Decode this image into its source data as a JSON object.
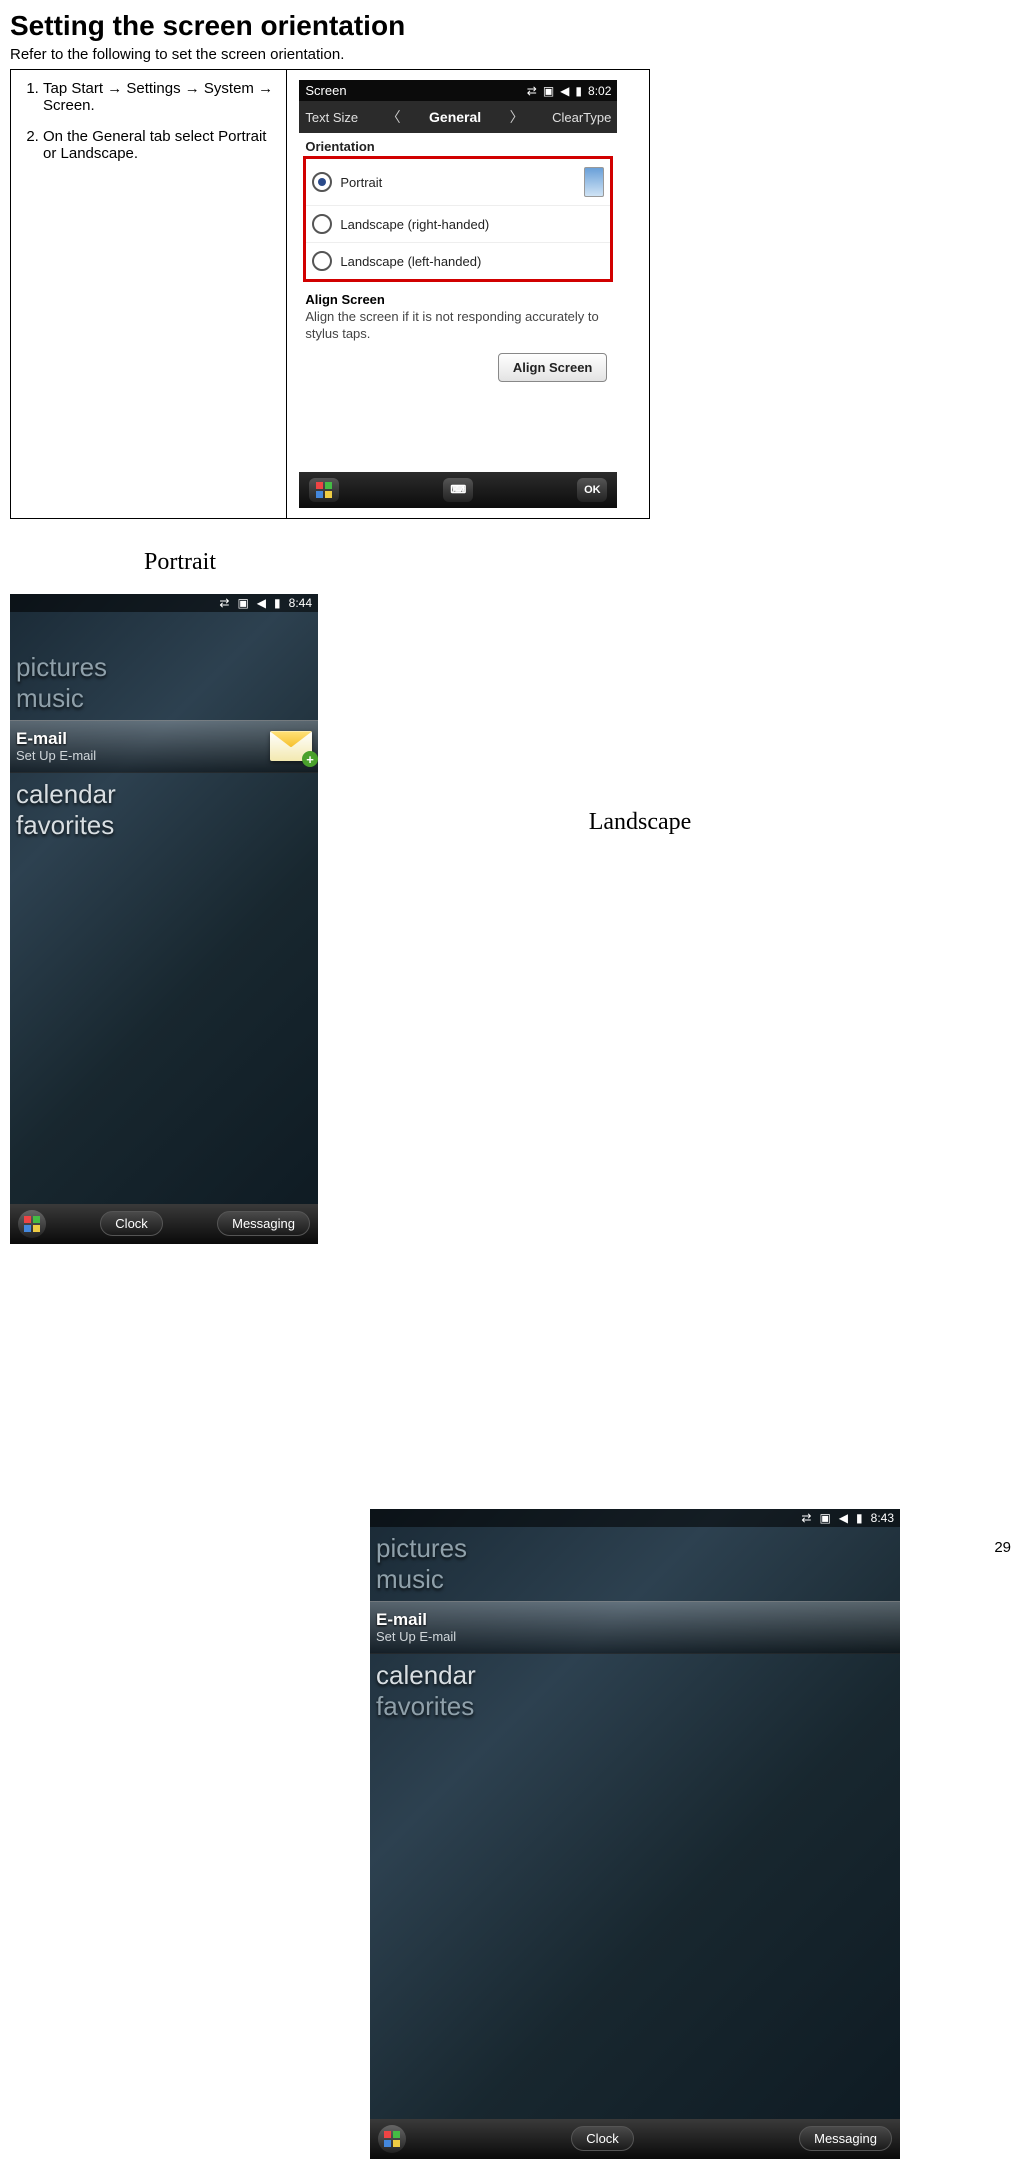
{
  "page_number": "29",
  "heading": "Setting the screen orientation",
  "intro": "Refer to the following to set the screen orientation.",
  "steps": [
    "Tap Start → Settings → System → Screen.",
    "On the General tab select Portrait or Landscape."
  ],
  "settings_screen": {
    "title": "Screen",
    "time": "8:02",
    "tabs": {
      "left": "Text Size",
      "mid": "General",
      "right": "ClearType"
    },
    "orientation_label": "Orientation",
    "options": {
      "portrait": "Portrait",
      "land_right": "Landscape (right-handed)",
      "land_left": "Landscape (left-handed)"
    },
    "align_head": "Align Screen",
    "align_text": "Align the screen if it is not responding accurately to stylus taps.",
    "align_button": "Align Screen",
    "ok": "OK"
  },
  "examples": {
    "portrait_label": "Portrait",
    "landscape_label": "Landscape",
    "portrait_time": "8:44",
    "landscape_time": "8:43",
    "items": {
      "pictures": "pictures",
      "music": "music",
      "calendar": "calendar",
      "favorites": "favorites"
    },
    "highlight": {
      "title": "E-mail",
      "sub": "Set Up E-mail"
    },
    "bottom": {
      "left": "Clock",
      "right": "Messaging"
    }
  }
}
